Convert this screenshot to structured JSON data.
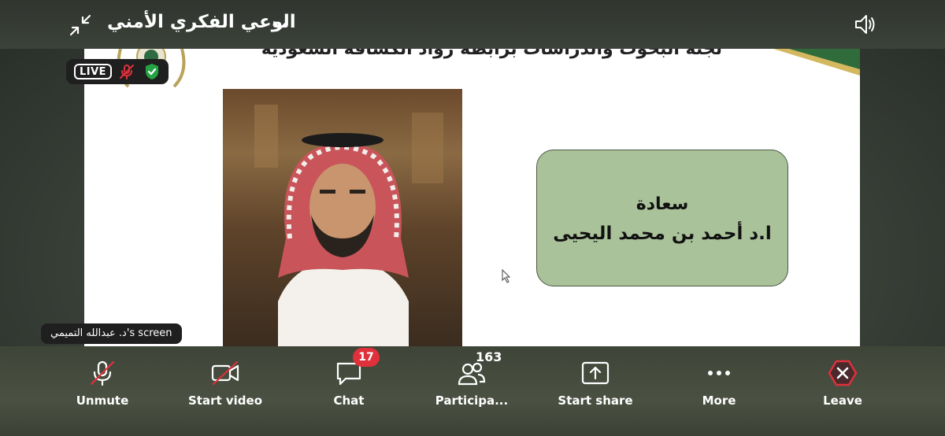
{
  "top_bar": {
    "title": "الوعي الفكري الأمني",
    "icons": {
      "exit_fullscreen": "exit-fullscreen-icon",
      "dropdown": "chevron-down-icon",
      "audio": "speaker-icon"
    }
  },
  "slide": {
    "header": "لجنة البحوث والدراسات برابطة رواد الكشافة السعودية",
    "name_box": {
      "line1": "سعادة",
      "line2": "ا.د أحمد بن محمد اليحيى"
    },
    "colors": {
      "box_fill": "#a9c29a",
      "ribbon_green": "#2f6b3b",
      "ribbon_gold": "#d4b860"
    }
  },
  "status": {
    "live_label": "LIVE",
    "mic_state": "muted",
    "security_state": "encrypted"
  },
  "screen_share_label": "د. عبدالله التميمي's screen",
  "toolbar": {
    "unmute": "Unmute",
    "start_video": "Start video",
    "chat": "Chat",
    "chat_badge": "17",
    "participants": "Participa...",
    "participants_count": "163",
    "start_share": "Start share",
    "more": "More",
    "leave": "Leave"
  }
}
